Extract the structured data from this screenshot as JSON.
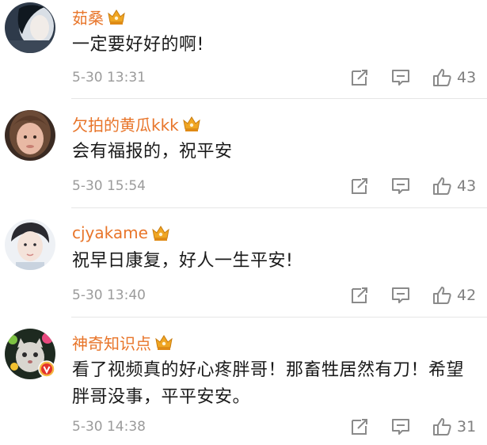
{
  "comments": [
    {
      "username": "茹桑",
      "text": "一定要好好的啊!",
      "time": "5-30 13:31",
      "likes": "43",
      "verified_badge": false
    },
    {
      "username": "欠拍的黄瓜kkk",
      "text": "会有福报的，祝平安",
      "time": "5-30 15:54",
      "likes": "43",
      "verified_badge": false
    },
    {
      "username": "cjyakame",
      "text": "祝早日康复，好人一生平安!",
      "time": "5-30 13:40",
      "likes": "42",
      "verified_badge": false
    },
    {
      "username": "神奇知识点",
      "text": "看了视频真的好心疼胖哥！那畜牲居然有刀！希望胖哥没事，平平安安。",
      "time": "5-30 14:38",
      "likes": "31",
      "verified_badge": true
    }
  ],
  "icons": {
    "crown": "crown-vip-icon",
    "forward": "forward-icon",
    "reply": "comment-icon",
    "like": "thumbs-up-icon",
    "verified": "verified-v-icon"
  },
  "colors": {
    "username": "#e8752a",
    "text": "#1a1a1a",
    "meta": "#9b9b9b",
    "icon": "#8a8a8a",
    "divider": "#e6e6e6",
    "crown": "#f0a623",
    "verified": "#e4322b"
  }
}
